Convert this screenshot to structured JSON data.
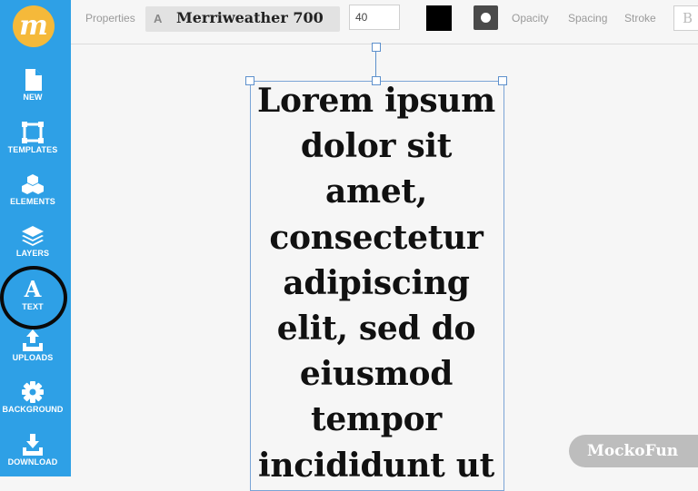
{
  "sidebar": {
    "logo_letter": "m",
    "items": [
      {
        "label": "NEW",
        "icon": "new-file-icon"
      },
      {
        "label": "TEMPLATES",
        "icon": "templates-icon"
      },
      {
        "label": "ELEMENTS",
        "icon": "elements-icon"
      },
      {
        "label": "LAYERS",
        "icon": "layers-icon"
      },
      {
        "label": "TEXT",
        "icon": "text-icon"
      },
      {
        "label": "UPLOADS",
        "icon": "upload-icon"
      },
      {
        "label": "BACKGROUND",
        "icon": "gear-icon"
      },
      {
        "label": "DOWNLOAD",
        "icon": "download-icon"
      }
    ]
  },
  "toolbar": {
    "properties_label": "Properties",
    "font_prefix": "A",
    "font_name": "Merriweather 700",
    "font_size": "40",
    "text_color": "#000000",
    "opacity_label": "Opacity",
    "spacing_label": "Spacing",
    "stroke_label": "Stroke",
    "bold_label": "B"
  },
  "canvas": {
    "text": "Lorem ipsum dolor sit amet, consectetur adipiscing elit, sed do eiusmod tempor incididunt ut"
  },
  "watermark": "MockoFun",
  "colors": {
    "sidebar": "#2ea0e6",
    "logo": "#f5b93a",
    "selection": "#5d90cc"
  }
}
